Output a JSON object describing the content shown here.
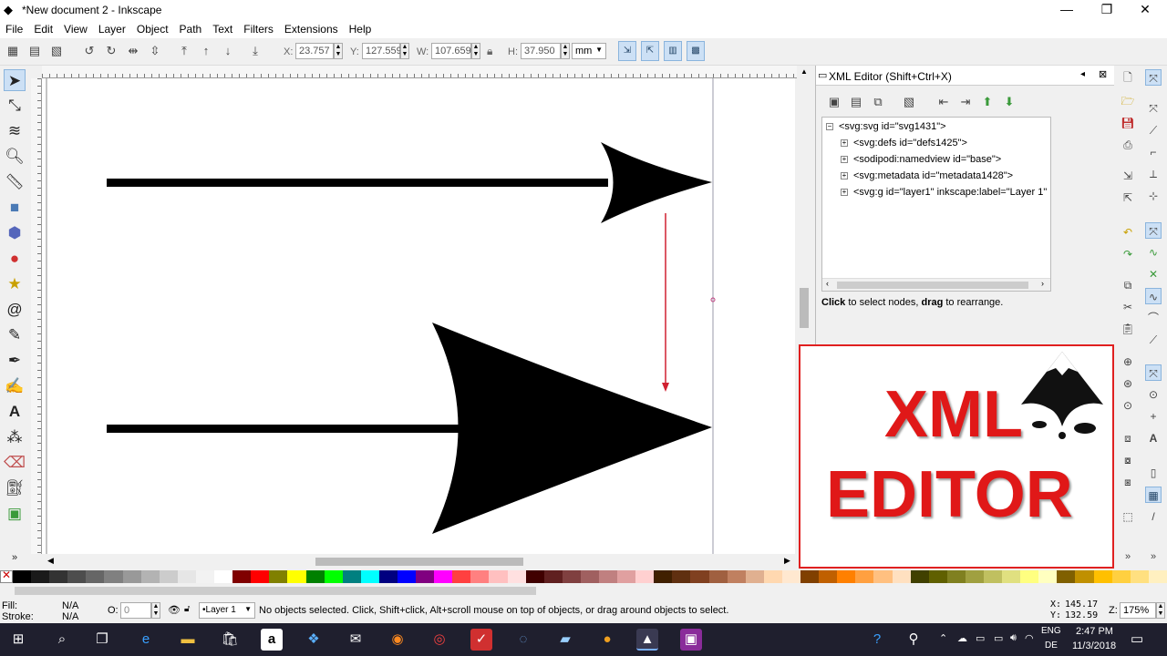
{
  "window": {
    "title": "*New document 2 - Inkscape"
  },
  "menu": [
    "File",
    "Edit",
    "View",
    "Layer",
    "Object",
    "Path",
    "Text",
    "Filters",
    "Extensions",
    "Help"
  ],
  "toolbar": {
    "x_label": "X:",
    "x_value": "23.757",
    "y_label": "Y:",
    "y_value": "127.559",
    "w_label": "W:",
    "w_value": "107.659",
    "h_label": "H:",
    "h_value": "37.950",
    "unit": "mm"
  },
  "xml_editor": {
    "title": "XML Editor (Shift+Ctrl+X)",
    "root": "<svg:svg id=\"svg1431\">",
    "nodes": [
      "<svg:defs id=\"defs1425\">",
      "<sodipodi:namedview id=\"base\">",
      "<svg:metadata id=\"metadata1428\">",
      "<svg:g id=\"layer1\" inkscape:label=\"Layer 1\""
    ],
    "hint_bold1": "Click",
    "hint_text1": " to select nodes, ",
    "hint_bold2": "drag",
    "hint_text2": " to rearrange."
  },
  "promo": {
    "line1": "XML",
    "line2": "EDITOR"
  },
  "status": {
    "fill_label": "Fill:",
    "fill_value": "N/A",
    "stroke_label": "Stroke:",
    "stroke_value": "N/A",
    "opacity_label": "O:",
    "opacity_value": "0",
    "layer": "•Layer 1",
    "message": "No objects selected. Click, Shift+click, Alt+scroll mouse on top of objects, or drag around objects to select.",
    "x_label": "X:",
    "x_value": "145.17",
    "y_label": "Y:",
    "y_value": "132.59",
    "zoom_label": "Z:",
    "zoom_value": "175%"
  },
  "taskbar": {
    "lang1": "ENG",
    "lang2": "DE",
    "time": "2:47 PM",
    "date": "11/3/2018"
  },
  "palette": [
    "#000000",
    "#1a1a1a",
    "#333333",
    "#4d4d4d",
    "#666666",
    "#808080",
    "#999999",
    "#b3b3b3",
    "#cccccc",
    "#e6e6e6",
    "#f2f2f2",
    "#ffffff",
    "#800000",
    "#ff0000",
    "#808000",
    "#ffff00",
    "#008000",
    "#00ff00",
    "#008080",
    "#00ffff",
    "#000080",
    "#0000ff",
    "#800080",
    "#ff00ff",
    "#ff4040",
    "#ff8080",
    "#ffc0c0",
    "#ffe0e0",
    "#400000",
    "#602020",
    "#804040",
    "#a06060",
    "#c08080",
    "#e0a0a0",
    "#ffd0d0",
    "#402000",
    "#603010",
    "#804020",
    "#a06040",
    "#c08060",
    "#e0b090",
    "#ffd8b0",
    "#ffe8d0",
    "#804000",
    "#c06000",
    "#ff8000",
    "#ffa040",
    "#ffc080",
    "#ffe0c0",
    "#404000",
    "#606000",
    "#808020",
    "#a0a040",
    "#c0c060",
    "#e0e080",
    "#ffff80",
    "#ffffc0",
    "#806000",
    "#c09000",
    "#ffc000",
    "#ffd040",
    "#ffe080",
    "#fff0c0"
  ]
}
